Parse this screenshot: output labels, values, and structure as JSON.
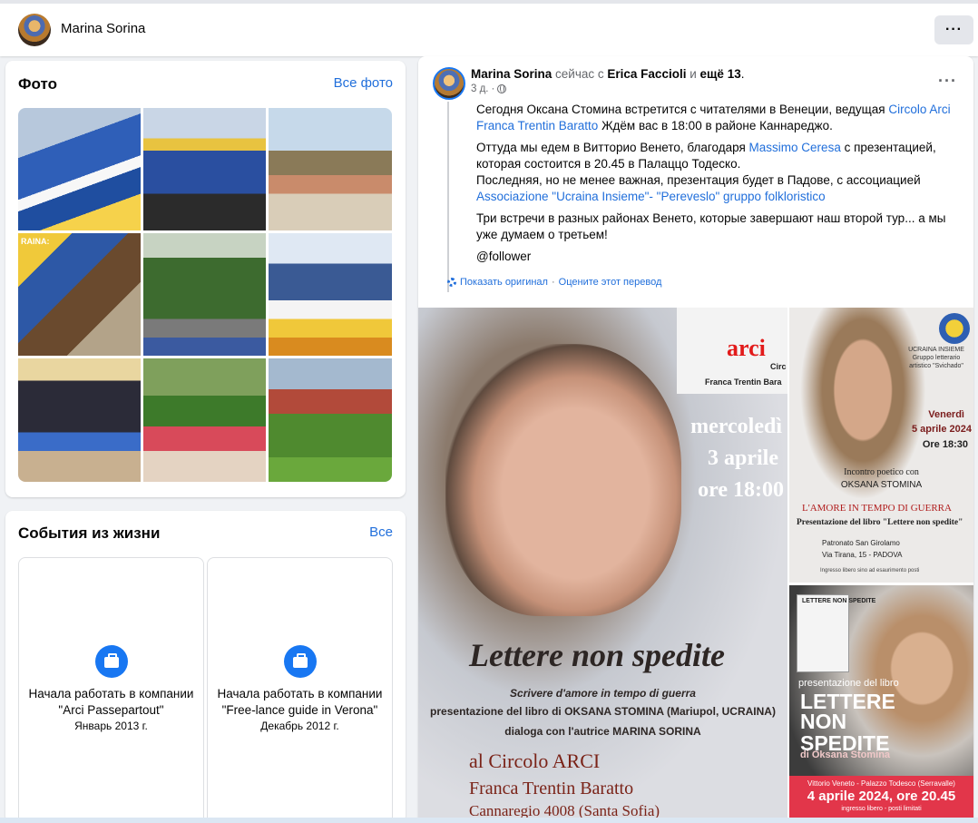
{
  "topbar": {
    "name": "Marina Sorina",
    "more_label": "···"
  },
  "photos": {
    "title": "Фото",
    "see_all": "Все фото",
    "items": [
      {
        "alt": "Флаги Израиля и НАТО на митинге"
      },
      {
        "alt": "Флаг НАТО на митинге"
      },
      {
        "alt": "Группа людей на прогулке"
      },
      {
        "alt": "Коллаж",
        "overlay_text": "RAINA:"
      },
      {
        "alt": "Пикет в парке"
      },
      {
        "alt": "Выступление с подсолнухами"
      },
      {
        "alt": "Собрание"
      },
      {
        "alt": "Пикник на траве"
      },
      {
        "alt": "Люди в парке"
      }
    ]
  },
  "events": {
    "title": "События из жизни",
    "see_all": "Все",
    "items": [
      {
        "title": "Начала работать в компании \"Arci Passepartout\"",
        "date": "Январь 2013 г."
      },
      {
        "title": "Начала работать в компании \"Free-lance guide in Verona\"",
        "date": "Декабрь 2012 г."
      }
    ]
  },
  "post": {
    "author": "Marina Sorina",
    "now_with": "сейчас с",
    "with_name": "Erica Faccioli",
    "and": "и",
    "others": "ещё 13",
    "dot": ".",
    "time": "3 д.",
    "sep": "·",
    "more": "···",
    "p1_a": "Сегодня Оксана Стомина встретится с читателями в Венеции, ведущая ",
    "p1_link": "Circolo Arci Franca Trentin Baratto",
    "p1_b": " Ждём вас в 18:00 в районе Каннареджо.",
    "p2_a": "Оттуда мы едем в Витторио Венето, благодаря ",
    "p2_link": "Massimo Ceresa",
    "p2_b": " с презентацией, которая состоится в 20.45 в Палаццо Тодеско.",
    "p2_c": "Последняя, но не менее важная, презентация будет в Падове, с ассоциацией ",
    "p2_link2": "Associazione \"Ucraina Insieme\"- \"Pereveslo\" gruppo folkloristico",
    "p3": "Три встречи в разных районах Венето, которые завершают наш второй тур... а мы уже думаем о третьем!",
    "p4": "@follower",
    "translate_show": "Показать оригинал",
    "translate_rate": "Оцените этот перевод"
  },
  "poster_big": {
    "arci": "arci",
    "arci_sub": "Franca Trentin Bara",
    "circ": "Circ",
    "date1": "mercoledì",
    "date2": "3 aprile",
    "date3": "ore 18:00",
    "title": "Lettere non spedite",
    "line1": "Scrivere d'amore in tempo di guerra",
    "line2": "presentazione del libro di OKSANA STOMINA (Mariupol, UCRAINA)",
    "line3": "dialoga con l'autrice MARINA SORINA",
    "line4": "al Circolo ARCI",
    "line5": "Franca Trentin Baratto",
    "line6": "Cannaregio 4008 (Santa Sofia)"
  },
  "poster_small1": {
    "org": "UCRAINA INSIEME Gruppo letterario artistico \"Svichado\"",
    "day": "Venerdì",
    "date": "5 aprile 2024",
    "time": "Ore 18:30",
    "l1": "Incontro poetico con",
    "l2": "OKSANA STOMINA",
    "l3": "L'AMORE IN TEMPO DI GUERRA",
    "l4": "Presentazione del libro \"Lettere non spedite\"",
    "l5": "Patronato San Girolamo",
    "l6": "Via Tirana, 15 - PADOVA",
    "l7": "Ingresso libero sino ad esaurimento posti"
  },
  "poster_small2": {
    "book": "LETTERE NON SPEDITE",
    "pres": "presentazione del libro",
    "b1": "LETTERE",
    "b2": "NON",
    "b3": "SPEDITE",
    "b4": "di Oksana Stomina",
    "c1": "Vittorio Veneto - Palazzo Todesco (Serravalle)",
    "c2": "4 aprile 2024, ore 20.45",
    "c3": "ingresso libero - posti limitati"
  }
}
